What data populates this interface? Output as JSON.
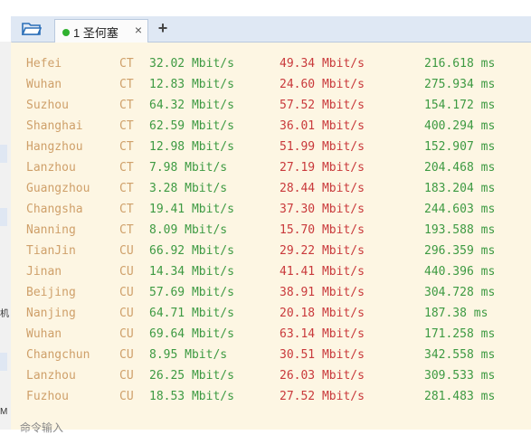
{
  "tab": {
    "number": "1",
    "title": "圣何塞",
    "close_glyph": "×",
    "add_glyph": "+"
  },
  "command_input": {
    "placeholder": "命令输入"
  },
  "left_panel": {
    "chars": [
      "机",
      "M"
    ]
  },
  "speedtest": {
    "rows": [
      {
        "city": "Hefei",
        "isp": "CT",
        "upload": "32.02 Mbit/s",
        "download": "49.34 Mbit/s",
        "latency": "216.618 ms"
      },
      {
        "city": "Wuhan",
        "isp": "CT",
        "upload": "12.83 Mbit/s",
        "download": "24.60 Mbit/s",
        "latency": "275.934 ms"
      },
      {
        "city": "Suzhou",
        "isp": "CT",
        "upload": "64.32 Mbit/s",
        "download": "57.52 Mbit/s",
        "latency": "154.172 ms"
      },
      {
        "city": "Shanghai",
        "isp": "CT",
        "upload": "62.59 Mbit/s",
        "download": "36.01 Mbit/s",
        "latency": "400.294 ms"
      },
      {
        "city": "Hangzhou",
        "isp": "CT",
        "upload": "12.98 Mbit/s",
        "download": "51.99 Mbit/s",
        "latency": "152.907 ms"
      },
      {
        "city": "Lanzhou",
        "isp": "CT",
        "upload": "7.98 Mbit/s",
        "download": "27.19 Mbit/s",
        "latency": "204.468 ms"
      },
      {
        "city": "Guangzhou",
        "isp": "CT",
        "upload": "3.28 Mbit/s",
        "download": "28.44 Mbit/s",
        "latency": "183.204 ms"
      },
      {
        "city": "Changsha",
        "isp": "CT",
        "upload": "19.41 Mbit/s",
        "download": "37.30 Mbit/s",
        "latency": "244.603 ms"
      },
      {
        "city": "Nanning",
        "isp": "CT",
        "upload": "8.09 Mbit/s",
        "download": "15.70 Mbit/s",
        "latency": "193.588 ms"
      },
      {
        "city": "TianJin",
        "isp": "CU",
        "upload": "66.92 Mbit/s",
        "download": "29.22 Mbit/s",
        "latency": "296.359 ms"
      },
      {
        "city": "Jinan",
        "isp": "CU",
        "upload": "14.34 Mbit/s",
        "download": "41.41 Mbit/s",
        "latency": "440.396 ms"
      },
      {
        "city": "Beijing",
        "isp": "CU",
        "upload": "57.69 Mbit/s",
        "download": "38.91 Mbit/s",
        "latency": "304.728 ms"
      },
      {
        "city": "Nanjing",
        "isp": "CU",
        "upload": "64.71 Mbit/s",
        "download": "20.18 Mbit/s",
        "latency": "187.38 ms"
      },
      {
        "city": "Wuhan",
        "isp": "CU",
        "upload": "69.64 Mbit/s",
        "download": "63.14 Mbit/s",
        "latency": "171.258 ms"
      },
      {
        "city": "Changchun",
        "isp": "CU",
        "upload": "8.95 Mbit/s",
        "download": "30.51 Mbit/s",
        "latency": "342.558 ms"
      },
      {
        "city": "Lanzhou",
        "isp": "CU",
        "upload": "26.25 Mbit/s",
        "download": "26.03 Mbit/s",
        "latency": "309.533 ms"
      },
      {
        "city": "Fuzhou",
        "isp": "CU",
        "upload": "18.53 Mbit/s",
        "download": "27.52 Mbit/s",
        "latency": "281.483 ms"
      }
    ]
  },
  "colors": {
    "city": "#cfa06a",
    "upload": "#3d9a42",
    "download": "#c9393b",
    "latency": "#3d9a42",
    "terminal_bg": "#fdf6e3",
    "tab_dot": "#2fb12f"
  }
}
